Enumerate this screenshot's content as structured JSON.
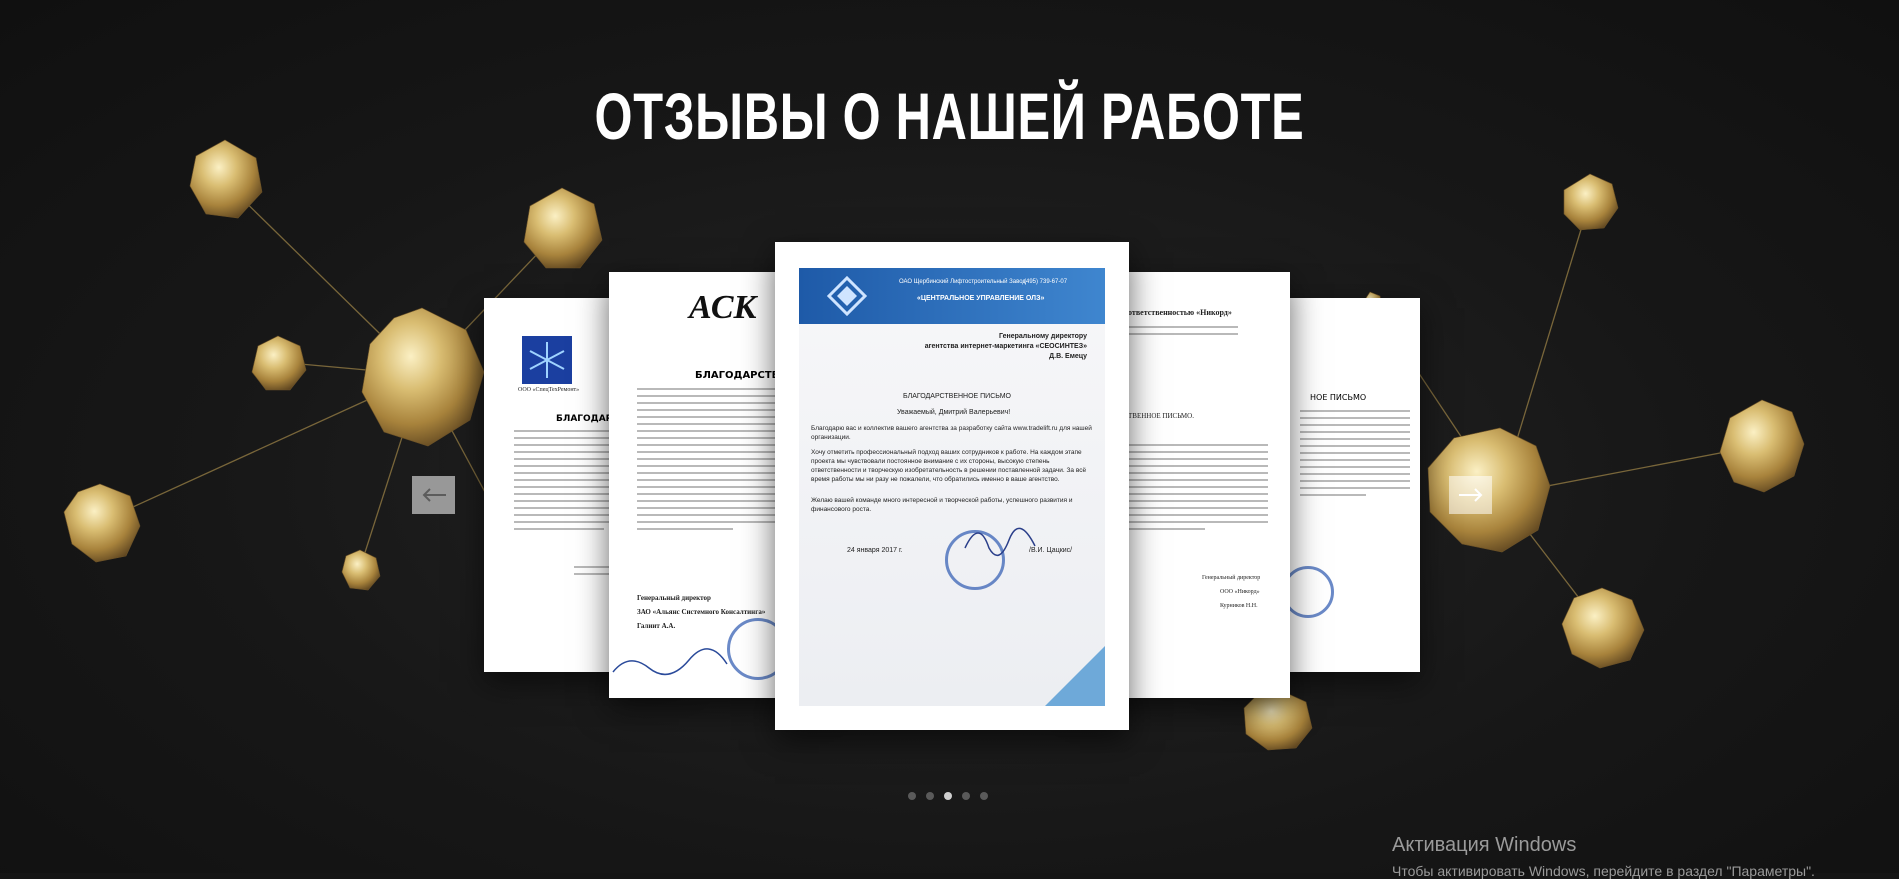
{
  "section": {
    "title": "ОТЗЫВЫ О НАШЕЙ РАБОТЕ"
  },
  "slider": {
    "prev_icon": "arrow-left-icon",
    "next_icon": "arrow-right-icon",
    "dots": [
      {
        "active": false
      },
      {
        "active": false
      },
      {
        "active": true
      },
      {
        "active": false
      },
      {
        "active": false
      }
    ]
  },
  "letters": {
    "far_left": {
      "org": "ООО «СпецТехРемонт»",
      "heading": "БЛАГОДАРСТ"
    },
    "left": {
      "logo_text": "АСК",
      "heading": "БЛАГОДАРСТВЕН",
      "sign_title": "Генеральный директор",
      "company": "ЗАО «Альянс Системного Консалтинга»",
      "signer": "Галиит А.А."
    },
    "center": {
      "header_org": "ОАО Щербинский Лифтостроительный Завод",
      "header_dept": "«ЦЕНТРАЛЬНОЕ УПРАВЛЕНИЕ ОЛЗ»",
      "phone": "(495) 739-67-07",
      "site": "www.tradelift.ru",
      "addressee_1": "Генеральному директору",
      "addressee_2": "агентства интернет-маркетинга «СЕОСИНТЕЗ»",
      "addressee_3": "Д.В. Емецу",
      "heading": "БЛАГОДАРСТВЕННОЕ ПИСЬМО",
      "greeting": "Уважаемый, Дмитрий Валерьевич!",
      "p1": "Благодарю вас и коллектив вашего агентства за разработку сайта www.tradelift.ru для нашей организации.",
      "p2": "Хочу отметить профессиональный подход ваших сотрудников к работе. На каждом этапе проекта мы чувствовали постоянное внимание с их стороны, высокую степень ответственности и творческую изобретательность в решении поставленной задачи. За всё время работы мы ни разу не пожалели, что обратились именно в ваше агентство.",
      "p3": "Желаю вашей команде много интересной и творческой работы, успешного развития и финансового роста.",
      "date": "24 января 2017 г.",
      "signer": "/В.И. Цацкис/"
    },
    "right": {
      "heading_org": "ответственностью «Никорд»",
      "heading": "ТВЕННОЕ ПИСЬМО.",
      "sign_title": "Генеральный директор",
      "company": "ООО «Никорд»",
      "signer": "Курников Н.Н."
    },
    "far_right": {
      "heading": "НОЕ ПИСЬМО"
    }
  },
  "os_overlay": {
    "title": "Активация Windows",
    "subtitle": "Чтобы активировать Windows, перейдите в раздел \"Параметры\"."
  }
}
